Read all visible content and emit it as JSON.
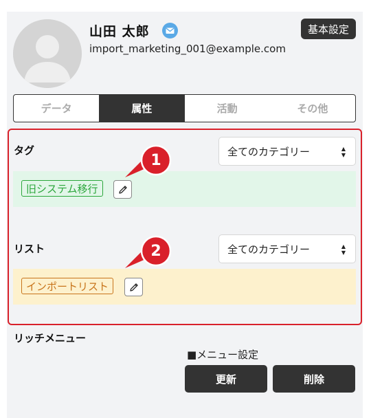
{
  "profile": {
    "name": "山田 太郎",
    "email": "import_marketing_001@example.com",
    "mail_icon": "mail-icon",
    "basic_settings_label": "基本設定"
  },
  "tabs": [
    {
      "label": "データ",
      "active": false
    },
    {
      "label": "属性",
      "active": true
    },
    {
      "label": "活動",
      "active": false
    },
    {
      "label": "その他",
      "active": false
    }
  ],
  "tag_section": {
    "label": "タグ",
    "category_select": "全てのカテゴリー",
    "chip": "旧システム移行",
    "chip_color": "#2aa63a",
    "bg_color": "#e2f6e9",
    "callout": "1"
  },
  "list_section": {
    "label": "リスト",
    "category_select": "全てのカテゴリー",
    "chip": "インポートリスト",
    "chip_color": "#c8741a",
    "bg_color": "#fdf1cd",
    "callout": "2"
  },
  "rich_menu": {
    "label": "リッチメニュー",
    "menu_setting": "■メニュー設定",
    "update_label": "更新",
    "delete_label": "削除"
  },
  "colors": {
    "highlight_border": "#d9202a",
    "callout": "#d9202a",
    "dark_button": "#333333"
  }
}
